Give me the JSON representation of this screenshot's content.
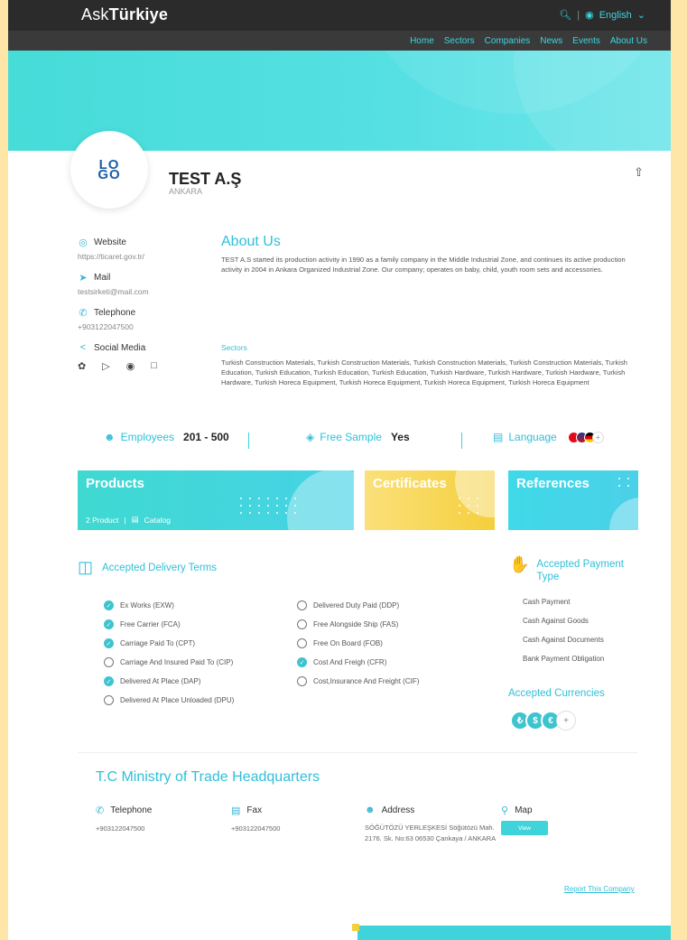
{
  "header": {
    "brand_prefix": "Ask",
    "brand_bold": "Türkiye",
    "search_icon": "search-icon",
    "language": "English"
  },
  "nav": [
    "Home",
    "Sectors",
    "Companies",
    "News",
    "Events",
    "About Us"
  ],
  "company": {
    "logo_top": "LO",
    "logo_bottom": "GO",
    "name": "TEST A.Ş",
    "city": "ANKARA"
  },
  "contacts": {
    "website_label": "Website",
    "website_value": "https://ticaret.gov.tr/",
    "mail_label": "Mail",
    "mail_value": "testsirketi@mail.com",
    "telephone_label": "Telephone",
    "telephone_value": "+903122047500",
    "social_label": "Social Media"
  },
  "about": {
    "title": "About Us",
    "text": "TEST A.S started its production activity in 1990 as a family company in the Middle Industrial Zone, and continues its active production activity in 2004 in Ankara Organized Industrial Zone. Our company; operates on baby, child, youth room sets and accessories."
  },
  "sectors": {
    "title": "Sectors",
    "text": "Turkish Construction Materials, Turkish Construction Materials, Turkish Construction Materials, Turkish Construction Materials, Turkish Education, Turkish Education, Turkish Education, Turkish Education, Turkish Hardware, Turkish Hardware, Turkish Hardware, Turkish Hardware, Turkish Horeca Equipment, Turkish Horeca Equipment, Turkish Horeca Equipment, Turkish Horeca Equipment"
  },
  "stats": {
    "employees_label": "Employees",
    "employees_value": "201 - 500",
    "sample_label": "Free Sample",
    "sample_value": "Yes",
    "language_label": "Language"
  },
  "cards": {
    "products": "Products",
    "products_sub": "2 Product",
    "catalog": "Catalog",
    "certificates": "Certificates",
    "references": "References"
  },
  "delivery": {
    "title": "Accepted Delivery Terms",
    "col1": [
      {
        "label": "Ex Works (EXW)",
        "checked": true
      },
      {
        "label": "Free Carrier (FCA)",
        "checked": true
      },
      {
        "label": "Carriage Paid To (CPT)",
        "checked": true
      },
      {
        "label": "Carriage And Insured Paid To (CIP)",
        "checked": false
      },
      {
        "label": "Delivered At Place (DAP)",
        "checked": true
      },
      {
        "label": "Delivered At Place Unloaded (DPU)",
        "checked": false
      }
    ],
    "col2": [
      {
        "label": "Delivered Duty Paid (DDP)",
        "checked": false
      },
      {
        "label": "Free Alongside Ship (FAS)",
        "checked": false
      },
      {
        "label": "Free On Board (FOB)",
        "checked": false
      },
      {
        "label": "Cost And Freigh (CFR)",
        "checked": true
      },
      {
        "label": "Cost,Insurance And Freight (CIF)",
        "checked": false
      }
    ]
  },
  "payment": {
    "title": "Accepted Payment Type",
    "items": [
      "Cash Payment",
      "Cash Against Goods",
      "Cash Against Documents",
      "Bank Payment Obligation"
    ]
  },
  "currencies": {
    "title": "Accepted Currencies",
    "symbols": [
      "₺",
      "$",
      "€",
      "+"
    ]
  },
  "ministry": {
    "title": "T.C Ministry of Trade Headquarters",
    "telephone_label": "Telephone",
    "telephone_value": "+903122047500",
    "fax_label": "Fax",
    "fax_value": "+903122047500",
    "address_label": "Address",
    "address_value": "SÖĞÜTÖZÜ YERLEŞKESİ Söğütözü Mah. 2176. Sk. No:63 06530 Çankaya / ANKARA",
    "map_label": "Map",
    "view_button": "View"
  },
  "report_link": "Report This Company",
  "colors": {
    "accent": "#2fc0d8",
    "check": "#3ec4cf",
    "certificates": "#f4cf3c"
  }
}
